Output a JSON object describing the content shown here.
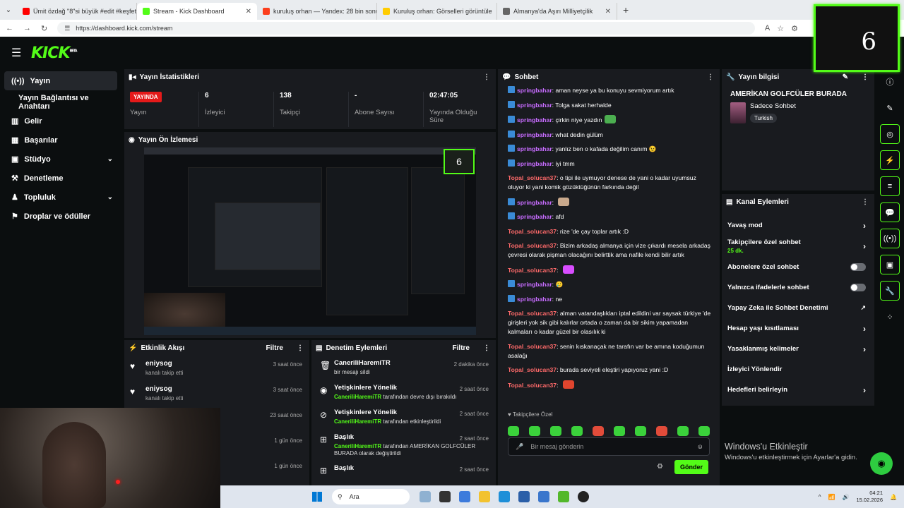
{
  "browser": {
    "tabs": [
      {
        "label": "Ümit özdağ \"8\"si büyük #edit #keşfetteyiz",
        "color": "#ff0000"
      },
      {
        "label": "Stream - Kick Dashboard",
        "color": "#53fc18"
      },
      {
        "label": "kuruluş orhan — Yandex: 28 bin sonuç bu",
        "color": "#fc3f1d"
      },
      {
        "label": "Kuruluş orhan: Görselleri görüntüle",
        "color": "#ffcc00"
      },
      {
        "label": "Almanya'da Aşırı Milliyetçilik",
        "color": "#666666"
      }
    ],
    "new_tab": "+",
    "close": "✕",
    "url": "https://dashboard.kick.com/stream"
  },
  "app": {
    "logo": "KICK",
    "logo_sup": "BETA"
  },
  "sidebar": {
    "items": [
      {
        "label": "Yayın",
        "icon": "broadcast-icon"
      },
      {
        "label": "Yayın Bağlantısı ve Anahtarı"
      },
      {
        "label": "Gelir",
        "icon": "chart-icon"
      },
      {
        "label": "Başarılar",
        "icon": "trophy-icon"
      },
      {
        "label": "Stüdyo",
        "icon": "studio-icon"
      },
      {
        "label": "Denetleme",
        "icon": "hammer-icon"
      },
      {
        "label": "Topluluk",
        "icon": "community-icon"
      },
      {
        "label": "Droplar ve ödüller",
        "icon": "gift-icon"
      }
    ]
  },
  "stats": {
    "title": "Yayın İstatistikleri",
    "live_badge": "YAYINDA",
    "live_label": "Yayın",
    "viewers_value": "6",
    "viewers_label": "İzleyici",
    "followers_value": "138",
    "followers_label": "Takipçi",
    "subs_value": "-",
    "subs_label": "Abone Sayısı",
    "duration_value": "02:47:05",
    "duration_label": "Yayında Olduğu Süre"
  },
  "preview": {
    "title": "Yayın Ön İzlemesi",
    "pip_number": "6"
  },
  "activity": {
    "title": "Etkinlik Akışı",
    "filter": "Filtre",
    "items": [
      {
        "name": "eniysog",
        "desc": "kanalı takip etti",
        "time": "3 saat önce"
      },
      {
        "name": "eniysog",
        "desc": "kanalı takip etti",
        "time": "3 saat önce"
      },
      {
        "name": "",
        "desc": "",
        "time": "23 saat önce"
      },
      {
        "name": "",
        "desc": "",
        "time": "1 gün önce"
      },
      {
        "name": "",
        "desc": "",
        "time": "1 gün önce"
      }
    ]
  },
  "moderation": {
    "title": "Denetim Eylemleri",
    "filter": "Filtre",
    "items": [
      {
        "title": "CaneriliHaremiTR",
        "user": "",
        "desc": "bir mesajı sildi",
        "time": "2 dakika önce",
        "icon": "trash-icon"
      },
      {
        "title": "Yetişkinlere Yönelik",
        "user": "CaneriliHaremiTR",
        "desc": "tarafından devre dışı bırakıldı",
        "time": "2 saat önce",
        "icon": "eye-icon"
      },
      {
        "title": "Yetişkinlere Yönelik",
        "user": "CaneriliHaremiTR",
        "desc": "tarafından etkinleştirildi",
        "time": "2 saat önce",
        "icon": "eye-off-icon"
      },
      {
        "title": "Başlık",
        "user": "CaneriliHaremiTR",
        "desc": "tarafından AMERİKAN GOLFCÜLER BURADA olarak değiştirildi",
        "time": "2 saat önce",
        "icon": "title-icon"
      },
      {
        "title": "Başlık",
        "user": "",
        "desc": "",
        "time": "2 saat önce",
        "icon": "title-icon"
      }
    ]
  },
  "chat": {
    "title": "Sohbet",
    "messages": [
      {
        "user": "springbahar",
        "type": "spring",
        "text": "aman neyse ya bu konuyu sevmiyorum artık"
      },
      {
        "user": "springbahar",
        "type": "spring",
        "text": "Tolga sakat herhalde"
      },
      {
        "user": "springbahar",
        "type": "spring",
        "text": "çirkin niye yazdın",
        "emote": "#4caf50"
      },
      {
        "user": "springbahar",
        "type": "spring",
        "text": "what dedin gülüm"
      },
      {
        "user": "springbahar",
        "type": "spring",
        "text": "yanlız ben o kafada değilim canım 😉"
      },
      {
        "user": "springbahar",
        "type": "spring",
        "text": "iyi tmm"
      },
      {
        "user": "Topal_solucan37",
        "type": "topal",
        "text": "o tipi ile uymuyor denese de yani o kadar uyumsuz oluyor ki yani komik gözüktüğünün farkında değil"
      },
      {
        "user": "springbahar",
        "type": "spring",
        "text": "",
        "emote": "#c9a98c"
      },
      {
        "user": "springbahar",
        "type": "spring",
        "text": "afd"
      },
      {
        "user": "Topal_solucan37",
        "type": "topal",
        "text": "rize 'de çay toplar artık :D"
      },
      {
        "user": "Topal_solucan37",
        "type": "topal",
        "text": "Bizim arkadaş almanya için vize çıkardı mesela arkadaş çevresi olarak pişman olacağını belirttik ama nafile kendi bilir artık"
      },
      {
        "user": "Topal_solucan37",
        "type": "topal",
        "text": "",
        "emote": "#d84dff"
      },
      {
        "user": "springbahar",
        "type": "spring",
        "text": "🥲"
      },
      {
        "user": "springbahar",
        "type": "spring",
        "text": "ne"
      },
      {
        "user": "Topal_solucan37",
        "type": "topal",
        "text": "alman vatandaşlıkları iptal edildini var saysak türkiye 'de girişleri yok sik gibi kalırlar ortada o zaman da bir sikim yapamadan kalmaları o kadar güzel bir olasılık ki"
      },
      {
        "user": "Topal_solucan37",
        "type": "topal",
        "text": "senin kıskanaçak ne tarafın var be amına koduğumun asalağı"
      },
      {
        "user": "Topal_solucan37",
        "type": "topal",
        "text": "burada seviyeli eleştiri yapıyoruz yani :D"
      },
      {
        "user": "Topal_solucan37",
        "type": "topal",
        "text": "",
        "emote": "#e0452e"
      }
    ],
    "followers_only": "♥ Takipçilere Özel",
    "input_placeholder": "Bir mesaj gönderin",
    "send": "Gönder"
  },
  "stream_info": {
    "title": "Yayın bilgisi",
    "stream_title": "AMERİKAN GOLFCÜLER BURADA",
    "category": "Sadece Sohbet",
    "tag": "Turkish"
  },
  "channel_actions": {
    "title": "Kanal Eylemleri",
    "items": [
      {
        "label": "Yavaş mod",
        "kind": "arrow"
      },
      {
        "label": "Takipçilere özel sohbet",
        "sub": "25 dk.",
        "kind": "arrow"
      },
      {
        "label": "Abonelere özel sohbet",
        "kind": "toggle"
      },
      {
        "label": "Yalnızca ifadelerle sohbet",
        "kind": "toggle"
      },
      {
        "label": "Yapay Zeka ile Sohbet Denetimi",
        "kind": "external"
      },
      {
        "label": "Hesap yaşı kısıtlaması",
        "kind": "arrow"
      },
      {
        "label": "Yasaklanmış kelimeler",
        "kind": "arrow"
      },
      {
        "label": "İzleyici Yönlendir",
        "kind": "none"
      },
      {
        "label": "Hedefleri belirleyin",
        "kind": "arrow"
      }
    ]
  },
  "pip": {
    "number": "6"
  },
  "taskbar": {
    "search": "Ara",
    "time": "04:21",
    "date": "15.02.2026"
  },
  "windows_watermark": {
    "line1": "Windows'u Etkinleştir",
    "line2": "Windows'u etkinleştirmek için Ayarlar'a gidin."
  }
}
